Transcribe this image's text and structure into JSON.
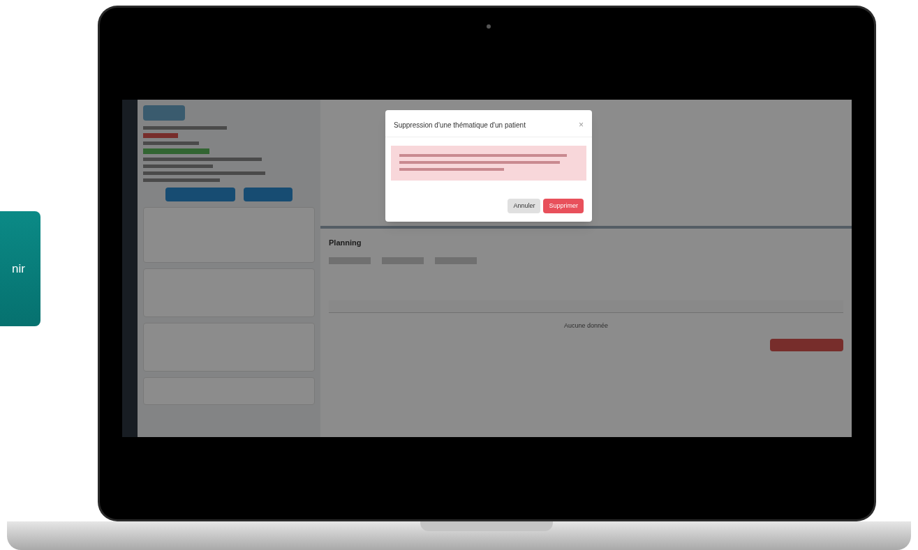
{
  "side_button": {
    "label": "nir"
  },
  "app": {
    "panel_title": "Planning",
    "table_empty": "Aucune donnée"
  },
  "modal": {
    "title": "Suppression d'une thématique d'un patient",
    "close": "×",
    "buttons": [
      {
        "label": "Annuler",
        "kind": "cancel"
      },
      {
        "label": "Supprimer",
        "kind": "danger"
      }
    ]
  }
}
